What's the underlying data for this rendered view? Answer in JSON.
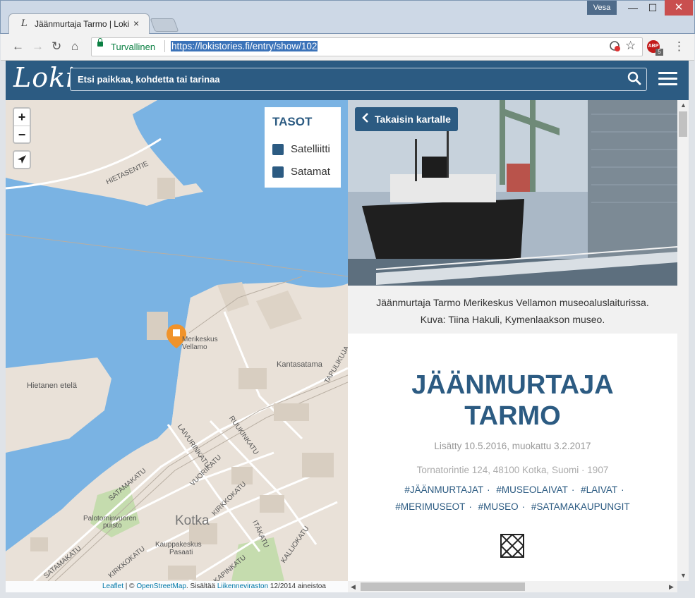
{
  "window": {
    "user": "Vesa",
    "minimize": "—",
    "maximize": "☐",
    "close": "✕"
  },
  "tab": {
    "favicon": "L",
    "title": "Jäänmurtaja Tarmo | Loki",
    "close": "×"
  },
  "toolbar": {
    "back": "←",
    "forward": "→",
    "reload": "↻",
    "home": "⌂",
    "secure_label": "Turvallinen",
    "url": "https://lokistories.fi/entry/show/102",
    "bookmark": "☆",
    "abp_label": "ABP",
    "abp_count": "5",
    "menu": "⋮"
  },
  "header": {
    "logo": "Loki",
    "search_placeholder": "Etsi paikkaa, kohdetta tai tarinaa"
  },
  "map": {
    "zoom_in": "+",
    "zoom_out": "−",
    "locate": "➤",
    "layers_title": "TASOT",
    "layers": [
      "Satelliitti",
      "Satamat"
    ],
    "labels": {
      "hietasentie": "HIETASENTIE",
      "merikeskus1": "Merikeskus",
      "merikeskus2": "Vellamo",
      "kantasatama": "Kantasatama",
      "hietanen": "Hietanen etelä",
      "tapulikuja": "TAPULIKUJA",
      "laivurinkatu": "LAIVURINKATU",
      "ruukinkatu": "RUUKINKATU",
      "satamakatu": "SATAMAKATU",
      "vuorikatu": "VUORIKATU",
      "kirkkokatu": "KIRKKOKATU",
      "palotorni1": "Palotorninvuoren",
      "palotorni2": "puisto",
      "kotka": "Kotka",
      "itakatu": "ITÄKATU",
      "kalliokatu": "KALLIOKATU",
      "kauppa1": "Kauppakeskus",
      "kauppa2": "Pasaati",
      "satamakatu2": "SATAMAKATU",
      "kirkkokatu2": "KIRKKOKATU",
      "kapinkatu": "KAPINKATU"
    },
    "attribution": {
      "leaflet": "Leaflet",
      "sep": " | © ",
      "osm": "OpenStreetMap",
      "text1": ". Sisältää ",
      "lv": "Liikenneviraston",
      "text2": " 12/2014 aineistoa"
    }
  },
  "panel": {
    "back_label": "Takaisin kartalle",
    "caption_line1": "Jäänmurtaja Tarmo Merikeskus Vellamon museoalus­laiturissa.",
    "caption_line2": "Kuva: Tiina Hakuli, Kymenlaakson museo.",
    "title_line1": "JÄÄNMURTAJA",
    "title_line2": "TARMO",
    "meta": "Lisätty 10.5.2016, muokattu 3.2.2017",
    "address": "Tornatorintie 124, 48100 Kotka, Suomi · 1907",
    "tags_row1": [
      "#JÄÄNMURTAJAT",
      "#MUSEOLAIVAT",
      "#LAIVAT"
    ],
    "tags_row2": [
      "#MERIMUSEOT",
      "#MUSEO",
      "#SATAMAKAUPUNGIT"
    ]
  },
  "colors": {
    "brand": "#2c5b82",
    "water": "#7ab3e3",
    "land": "#e9e1d8",
    "park": "#c5dcae",
    "marker": "#f0932b"
  }
}
